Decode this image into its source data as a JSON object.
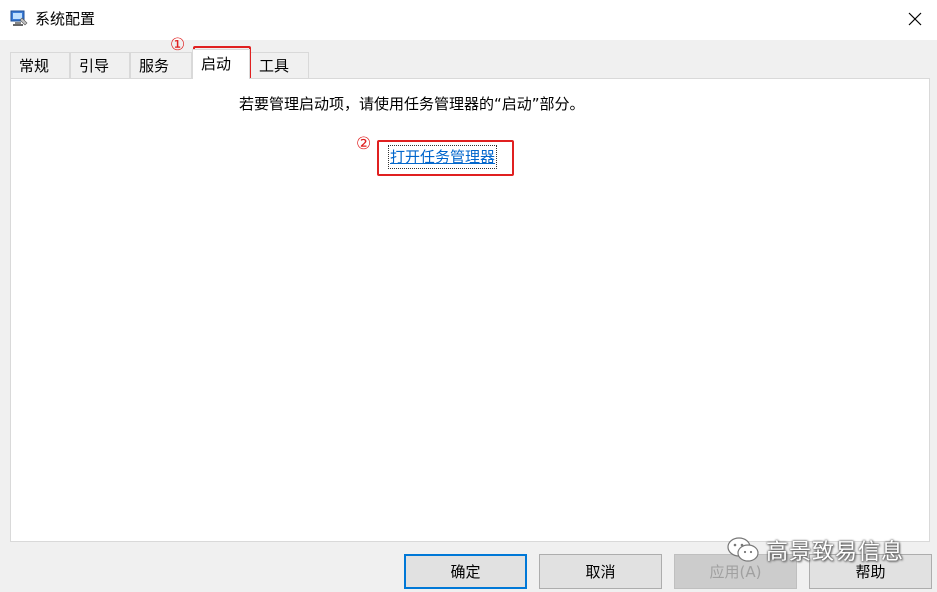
{
  "window": {
    "title": "系统配置",
    "close_label": "✕"
  },
  "tabs": [
    {
      "label": "常规"
    },
    {
      "label": "引导"
    },
    {
      "label": "服务"
    },
    {
      "label": "启动",
      "active": true
    },
    {
      "label": "工具"
    }
  ],
  "startup_panel": {
    "info_text": "若要管理启动项，请使用任务管理器的“启动”部分。",
    "link_text": "打开任务管理器"
  },
  "annotations": {
    "step1": "①",
    "step2": "②",
    "accent_color": "#e02020"
  },
  "buttons": {
    "ok": "确定",
    "cancel": "取消",
    "apply": "应用(A)",
    "help": "帮助"
  },
  "watermark": {
    "text": "高景致易信息",
    "icon": "wechat-icon"
  }
}
